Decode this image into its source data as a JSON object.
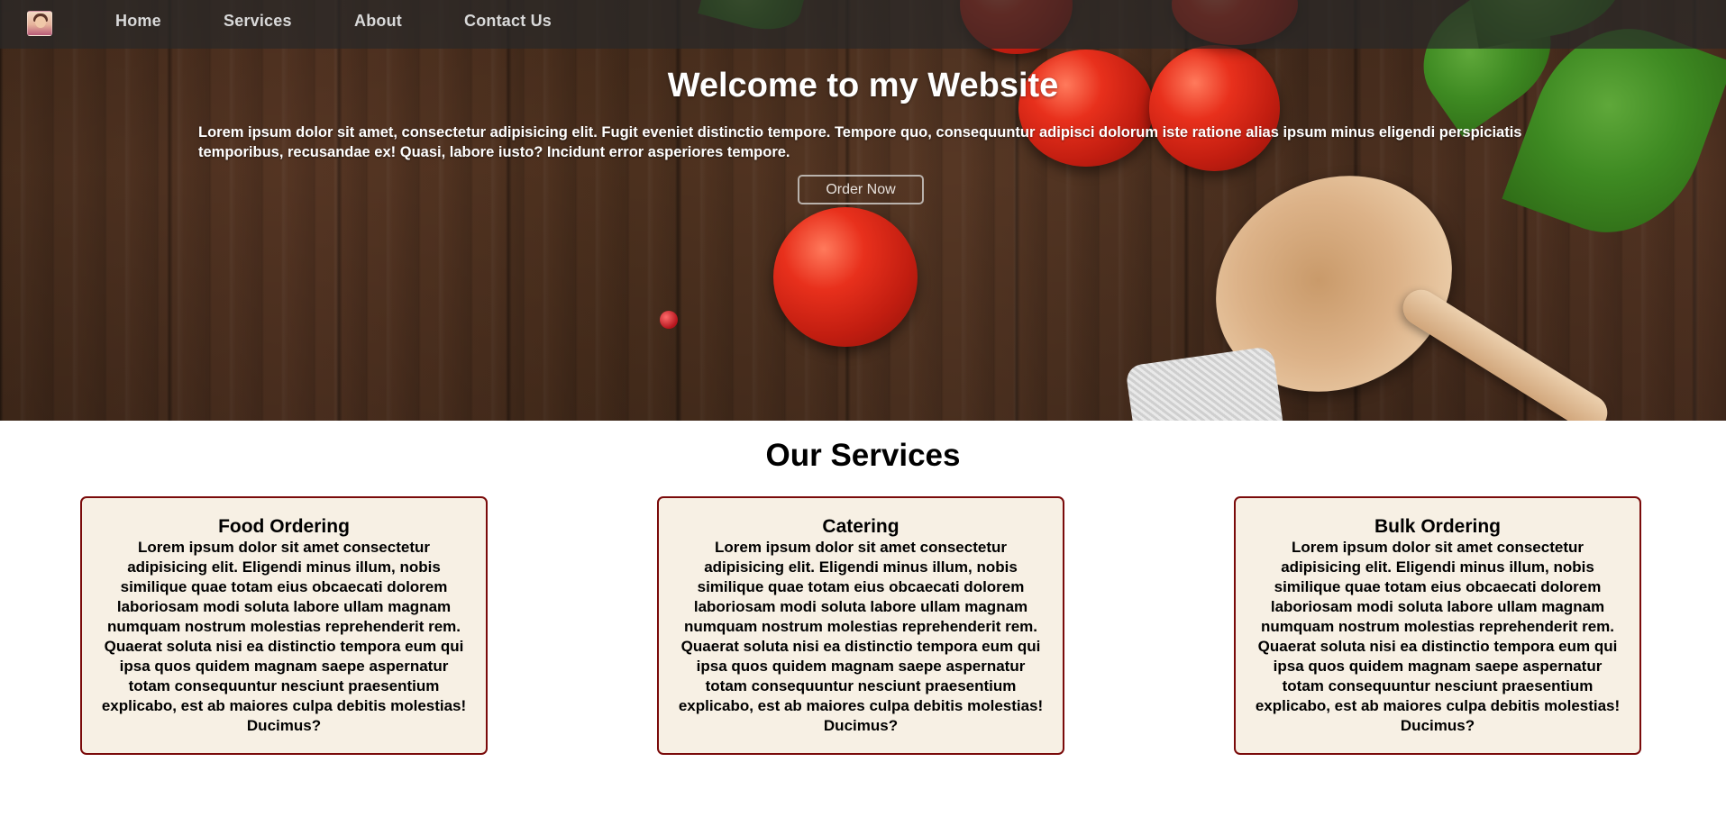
{
  "nav": {
    "logo_alt": "profile avatar",
    "links": [
      {
        "label": "Home"
      },
      {
        "label": "Services"
      },
      {
        "label": "About"
      },
      {
        "label": "Contact Us"
      }
    ]
  },
  "hero": {
    "title": "Welcome to my Website",
    "text": "Lorem ipsum dolor sit amet, consectetur adipisicing elit. Fugit eveniet distinctio tempore. Tempore quo, consequuntur adipisci dolorum iste ratione alias ipsum minus eligendi perspiciatis temporibus, recusandae ex! Quasi, labore iusto? Incidunt error asperiores tempore.",
    "button_label": "Order Now"
  },
  "services": {
    "title": "Our Services",
    "cards": [
      {
        "title": "Food Ordering",
        "text": "Lorem ipsum dolor sit amet consectetur adipisicing elit. Eligendi minus illum, nobis similique quae totam eius obcaecati dolorem laboriosam modi soluta labore ullam magnam numquam nostrum molestias reprehenderit rem. Quaerat soluta nisi ea distinctio tempora eum qui ipsa quos quidem magnam saepe aspernatur totam consequuntur nesciunt praesentium explicabo, est ab maiores culpa debitis molestias! Ducimus?"
      },
      {
        "title": "Catering",
        "text": "Lorem ipsum dolor sit amet consectetur adipisicing elit. Eligendi minus illum, nobis similique quae totam eius obcaecati dolorem laboriosam modi soluta labore ullam magnam numquam nostrum molestias reprehenderit rem. Quaerat soluta nisi ea distinctio tempora eum qui ipsa quos quidem magnam saepe aspernatur totam consequuntur nesciunt praesentium explicabo, est ab maiores culpa debitis molestias! Ducimus?"
      },
      {
        "title": "Bulk Ordering",
        "text": "Lorem ipsum dolor sit amet consectetur adipisicing elit. Eligendi minus illum, nobis similique quae totam eius obcaecati dolorem laboriosam modi soluta labore ullam magnam numquam nostrum molestias reprehenderit rem. Quaerat soluta nisi ea distinctio tempora eum qui ipsa quos quidem magnam saepe aspernatur totam consequuntur nesciunt praesentium explicabo, est ab maiores culpa debitis molestias! Ducimus?"
      }
    ]
  },
  "colors": {
    "card_border": "#7a0a0a",
    "card_bg": "#f7f0e4",
    "nav_bg": "#282828"
  }
}
